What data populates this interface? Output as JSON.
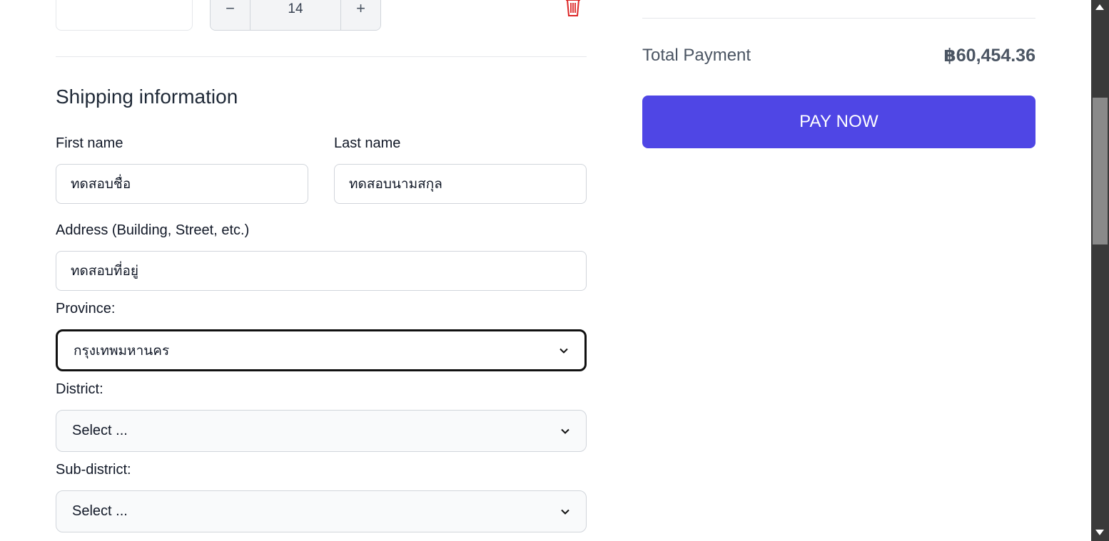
{
  "cart": {
    "quantity_value": "14",
    "decrement_symbol": "−",
    "increment_symbol": "+"
  },
  "shipping": {
    "section_title": "Shipping information",
    "first_name_label": "First name",
    "first_name_value": "ทดสอบชื่อ",
    "last_name_label": "Last name",
    "last_name_value": "ทดสอบนามสกุล",
    "address_label": "Address (Building, Street, etc.)",
    "address_value": "ทดสอบที่อยู่",
    "province_label": "Province:",
    "province_value": "กรุงเทพมหานคร",
    "district_label": "District:",
    "district_value": "Select ...",
    "subdistrict_label": "Sub-district:",
    "subdistrict_value": "Select ..."
  },
  "summary": {
    "total_label": "Total Payment",
    "total_value": "฿60,454.36",
    "pay_button": "PAY NOW"
  },
  "colors": {
    "accent": "#4f46e5",
    "delete": "#dc2626",
    "scrollbar_track": "#3a3a3a",
    "scrollbar_thumb": "#8a8a8a"
  },
  "icons": {
    "trash": "trash-icon",
    "chevron": "chevron-down-icon",
    "minus": "minus-icon",
    "plus": "plus-icon"
  }
}
